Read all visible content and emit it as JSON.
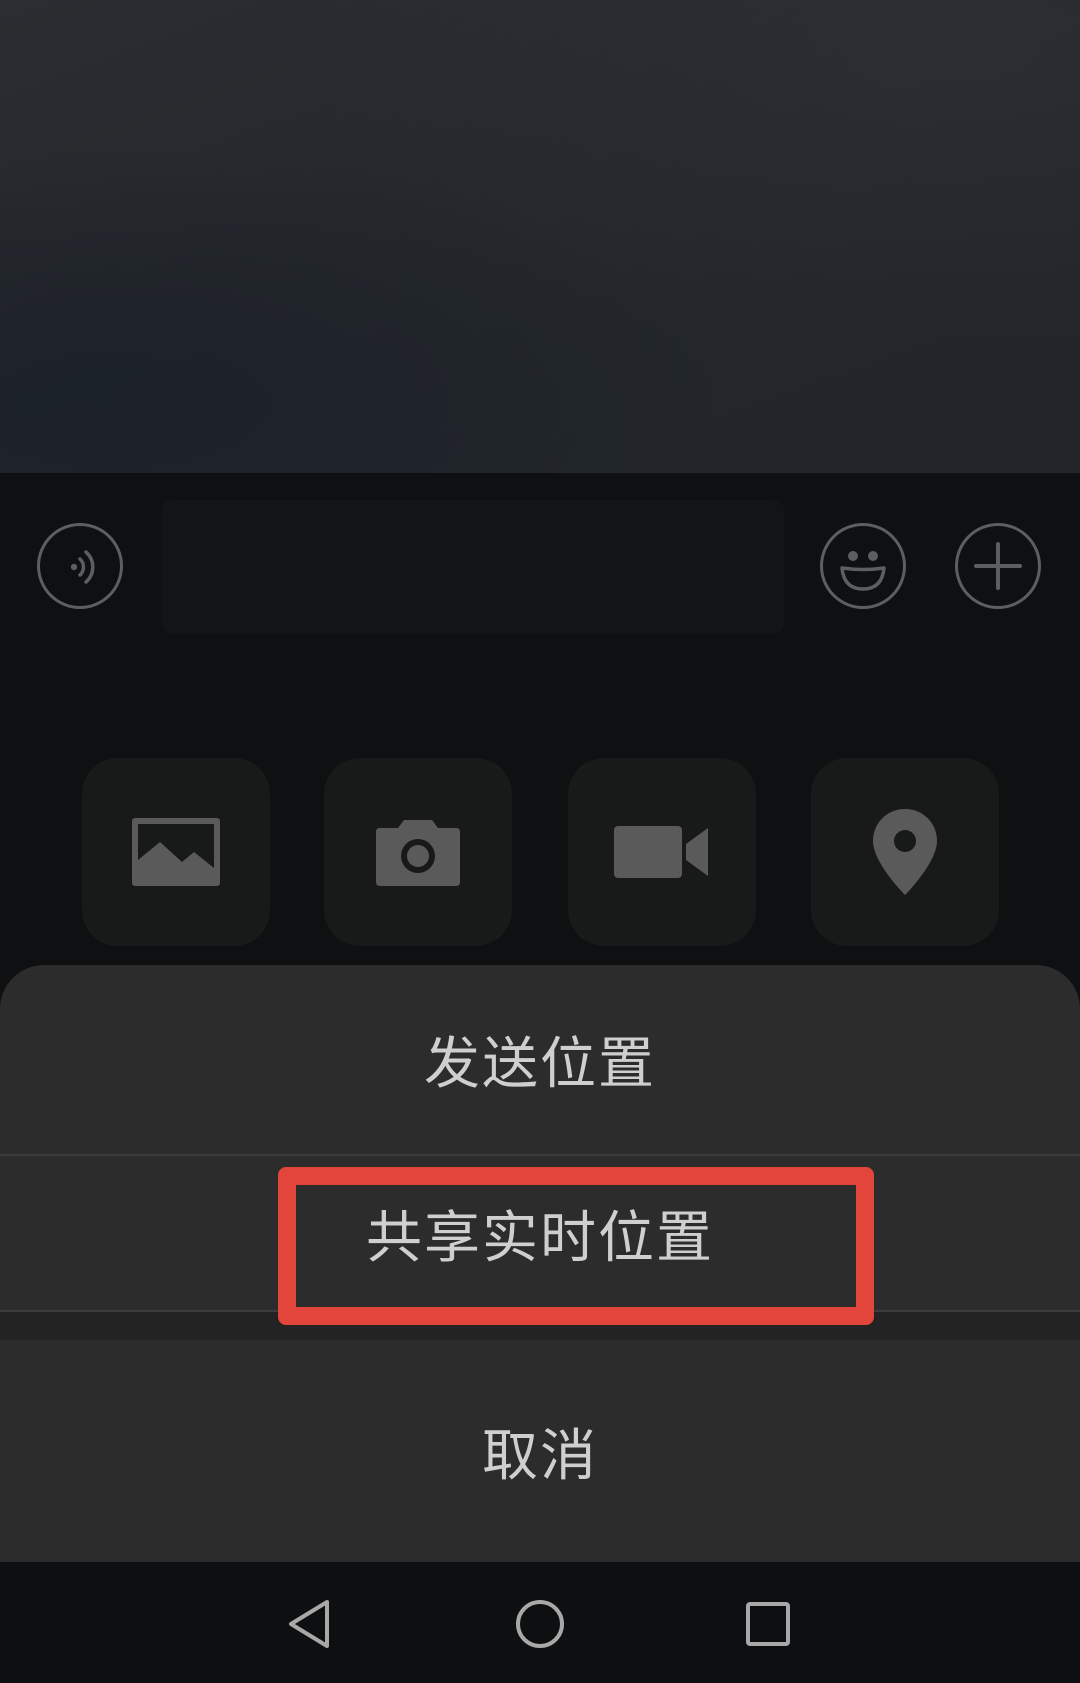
{
  "input_bar": {
    "voice_icon": "voice-input-icon",
    "text_value": "",
    "emoji_icon": "emoji-icon",
    "plus_icon": "plus-icon"
  },
  "panel": {
    "tiles": [
      {
        "icon": "image-icon"
      },
      {
        "icon": "camera-icon"
      },
      {
        "icon": "video-call-icon"
      },
      {
        "icon": "location-pin-icon"
      }
    ]
  },
  "sheet": {
    "send_location": "发送位置",
    "share_live_location": "共享实时位置",
    "cancel": "取消"
  },
  "highlight_color": "#e2453a",
  "nav": {
    "back_icon": "back-triangle-icon",
    "home_icon": "home-circle-icon",
    "recent_icon": "recent-apps-square-icon"
  }
}
